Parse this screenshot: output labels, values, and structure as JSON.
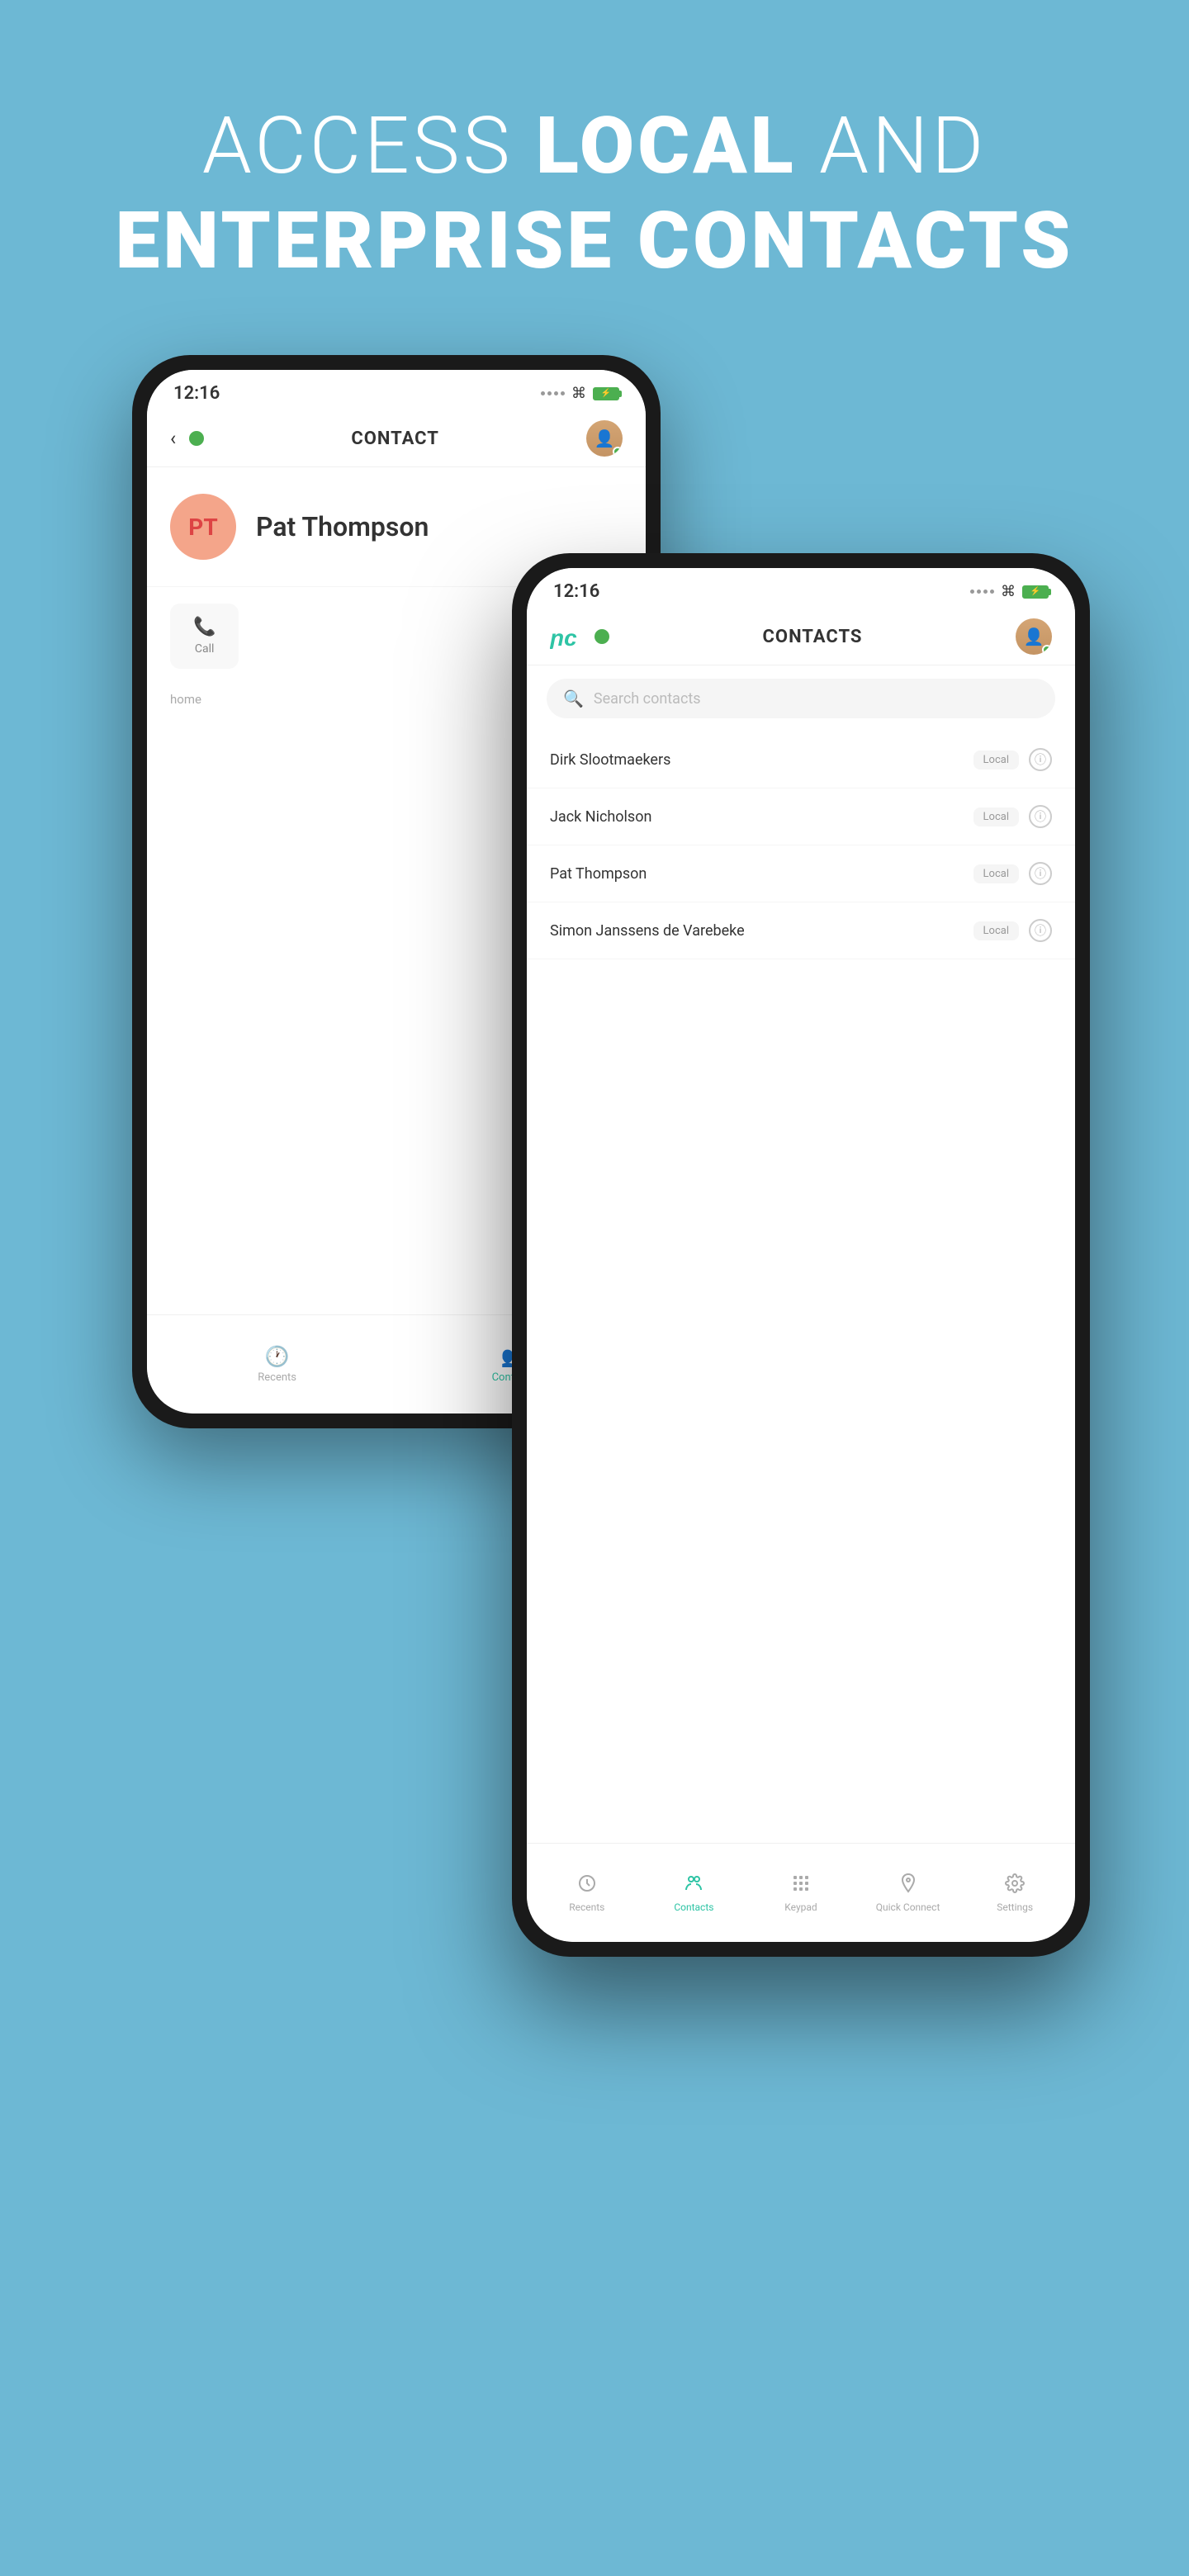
{
  "header": {
    "line1_normal": "ACCESS ",
    "line1_bold": "LOCAL",
    "line1_end": " AND",
    "line2": "ENTERPRISE CONTACTS"
  },
  "back_phone": {
    "status_time": "12:16",
    "nav_title": "CONTACT",
    "contact_initials": "PT",
    "contact_name": "Pat Thompson",
    "action_call_label": "Call",
    "section_label": "home",
    "nav_recents_label": "Recents",
    "nav_contacts_label": "Contacts"
  },
  "front_phone": {
    "status_time": "12:16",
    "nav_title": "CONTACTS",
    "search_placeholder": "Search contacts",
    "contacts": [
      {
        "name": "Dirk Slootmaekers",
        "badge": "Local"
      },
      {
        "name": "Jack Nicholson",
        "badge": "Local"
      },
      {
        "name": "Pat Thompson",
        "badge": "Local"
      },
      {
        "name": "Simon Janssens de Varebeke",
        "badge": "Local"
      }
    ],
    "nav_items": [
      {
        "label": "Recents",
        "icon": "clock"
      },
      {
        "label": "Contacts",
        "icon": "people",
        "active": true
      },
      {
        "label": "Keypad",
        "icon": "grid"
      },
      {
        "label": "Quick Connect",
        "icon": "headset"
      },
      {
        "label": "Settings",
        "icon": "gear"
      }
    ]
  }
}
